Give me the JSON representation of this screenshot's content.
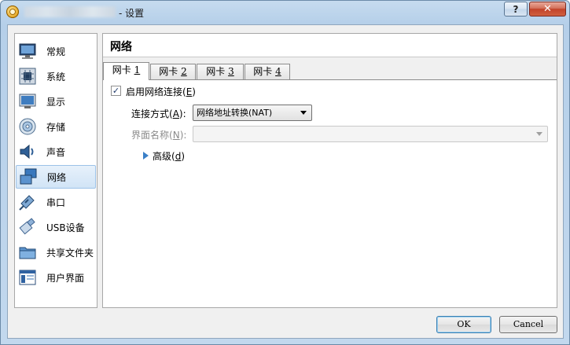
{
  "window": {
    "title": "- 设置",
    "help_label": "?",
    "close_label": "✕"
  },
  "sidebar": {
    "items": [
      {
        "label": "常规",
        "icon": "monitor-icon"
      },
      {
        "label": "系统",
        "icon": "chip-icon"
      },
      {
        "label": "显示",
        "icon": "display-icon"
      },
      {
        "label": "存储",
        "icon": "disk-icon"
      },
      {
        "label": "声音",
        "icon": "speaker-icon"
      },
      {
        "label": "网络",
        "icon": "network-icon"
      },
      {
        "label": "串口",
        "icon": "serial-port-icon"
      },
      {
        "label": "USB设备",
        "icon": "usb-icon"
      },
      {
        "label": "共享文件夹",
        "icon": "folder-icon"
      },
      {
        "label": "用户界面",
        "icon": "window-layout-icon"
      }
    ],
    "selected": "网络"
  },
  "main": {
    "title": "网络",
    "tabs": [
      {
        "label": "网卡",
        "num": "1"
      },
      {
        "label": "网卡",
        "num": "2"
      },
      {
        "label": "网卡",
        "num": "3"
      },
      {
        "label": "网卡",
        "num": "4"
      }
    ],
    "enable": {
      "label": "启用网络连接",
      "shortcut": "E",
      "checked": true,
      "check_mark": "✓"
    },
    "attached": {
      "label": "连接方式",
      "shortcut": "A",
      "value": "网络地址转换(NAT)"
    },
    "name": {
      "label": "界面名称",
      "shortcut": "N",
      "value": ""
    },
    "advanced": {
      "label": "高级",
      "shortcut": "d"
    }
  },
  "buttons": {
    "ok": "OK",
    "cancel": "Cancel"
  },
  "colors": {
    "selected_bg": "#d9e8f7",
    "accent_arrow": "#3a7fc7"
  }
}
